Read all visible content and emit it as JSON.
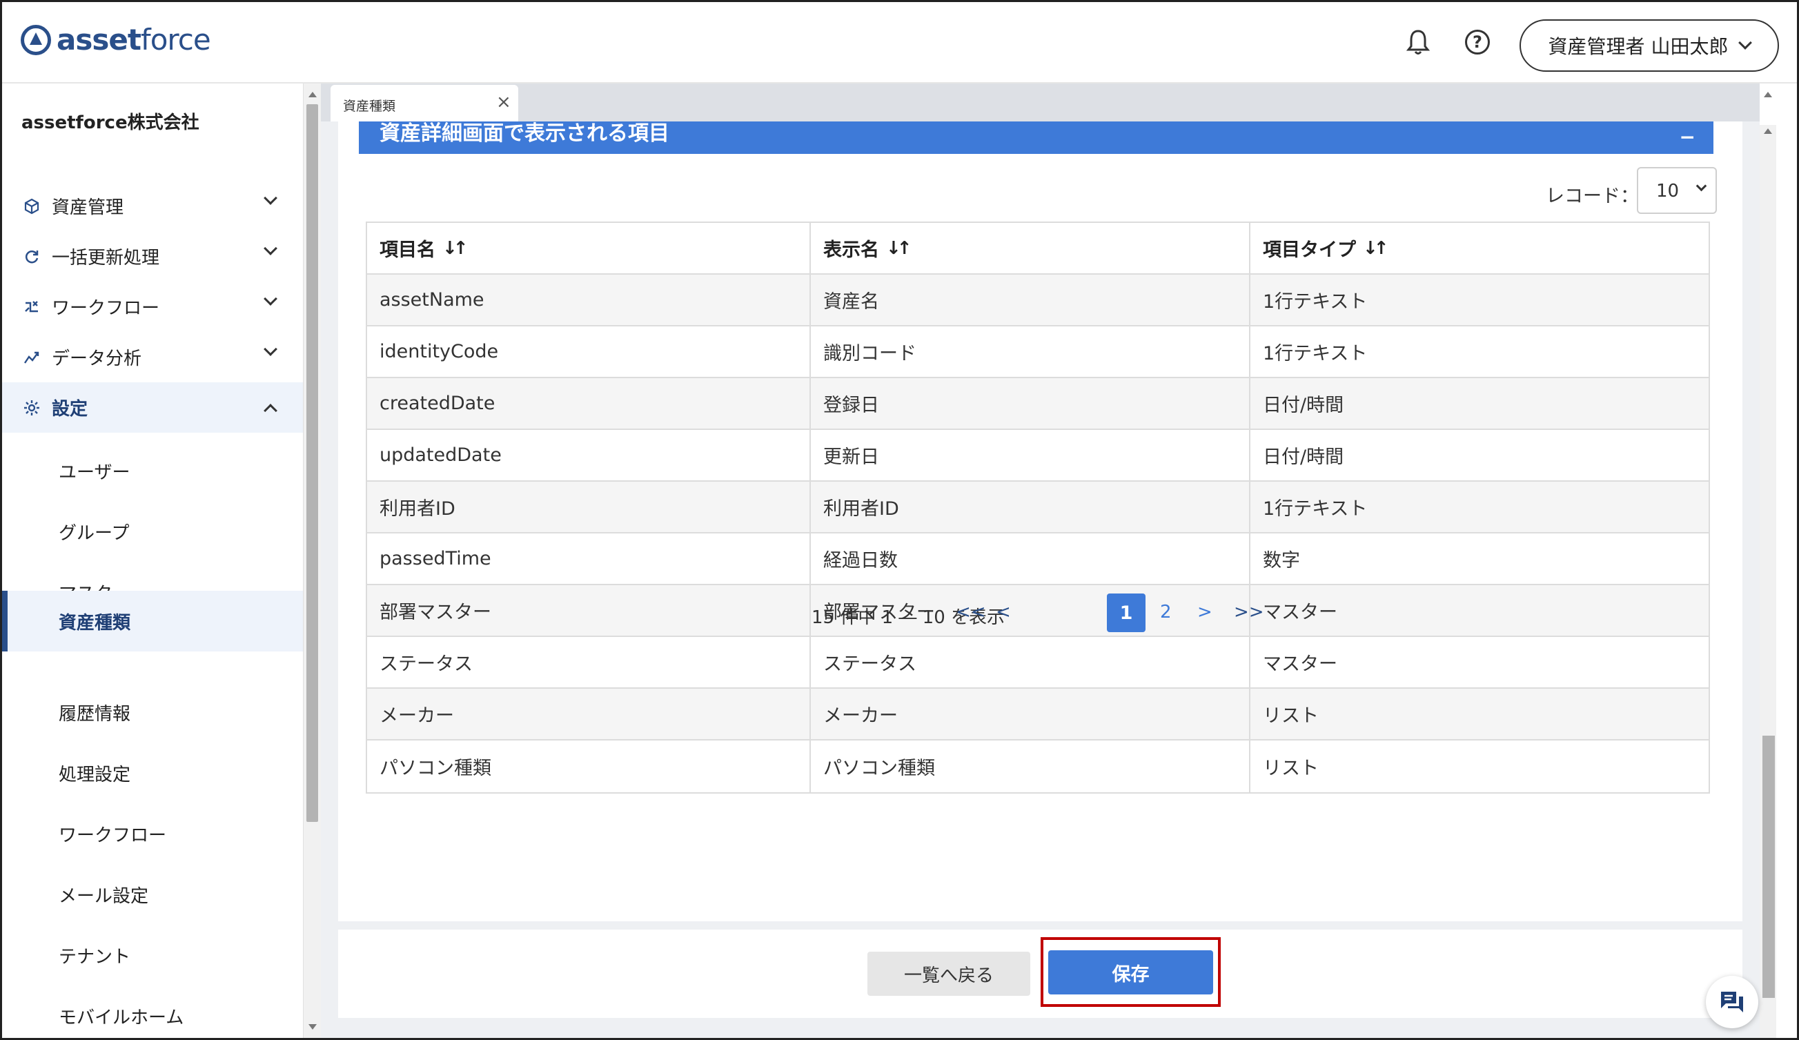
{
  "header": {
    "logo_bold": "asset",
    "logo_light": "force",
    "user_label": "資産管理者 山田太郎",
    "icons": [
      "bell-icon",
      "help-icon",
      "chevron-down-icon"
    ]
  },
  "sidebar": {
    "company": "assetforce株式会社",
    "nav": [
      {
        "label": "資産管理",
        "icon": "cube-icon"
      },
      {
        "label": "一括更新処理",
        "icon": "refresh-icon"
      },
      {
        "label": "ワークフロー",
        "icon": "workflow-icon"
      },
      {
        "label": "データ分析",
        "icon": "analytics-icon"
      },
      {
        "label": "設定",
        "icon": "gear-icon"
      }
    ],
    "sub": [
      "ユーザー",
      "グループ",
      "マスター",
      "資産種類",
      "履歴情報",
      "処理設定",
      "ワークフロー",
      "メール設定",
      "テナント",
      "モバイルホーム"
    ]
  },
  "tab": {
    "label": "資産種類"
  },
  "section": {
    "title": "資産詳細画面で表示される項目",
    "collapse": "−"
  },
  "records": {
    "label": "レコード：",
    "value": "10"
  },
  "table": {
    "headers": [
      "項目名",
      "表示名",
      "項目タイプ"
    ],
    "rows": [
      [
        "assetName",
        "資産名",
        "1行テキスト"
      ],
      [
        "identityCode",
        "識別コード",
        "1行テキスト"
      ],
      [
        "createdDate",
        "登録日",
        "日付/時間"
      ],
      [
        "updatedDate",
        "更新日",
        "日付/時間"
      ],
      [
        "利用者ID",
        "利用者ID",
        "1行テキスト"
      ],
      [
        "passedTime",
        "経過日数",
        "数字"
      ],
      [
        "部署マスター",
        "部署マスター",
        "マスター"
      ],
      [
        "ステータス",
        "ステータス",
        "マスター"
      ],
      [
        "メーカー",
        "メーカー",
        "リスト"
      ],
      [
        "パソコン種類",
        "パソコン種類",
        "リスト"
      ]
    ]
  },
  "pager": {
    "info": "15 件中 1 ― 10 を表示",
    "first": "<<",
    "prev": "<",
    "current": "1",
    "page2": "2",
    "next": ">",
    "last": ">>"
  },
  "buttons": {
    "back": "一覧へ戻る",
    "save": "保存"
  }
}
